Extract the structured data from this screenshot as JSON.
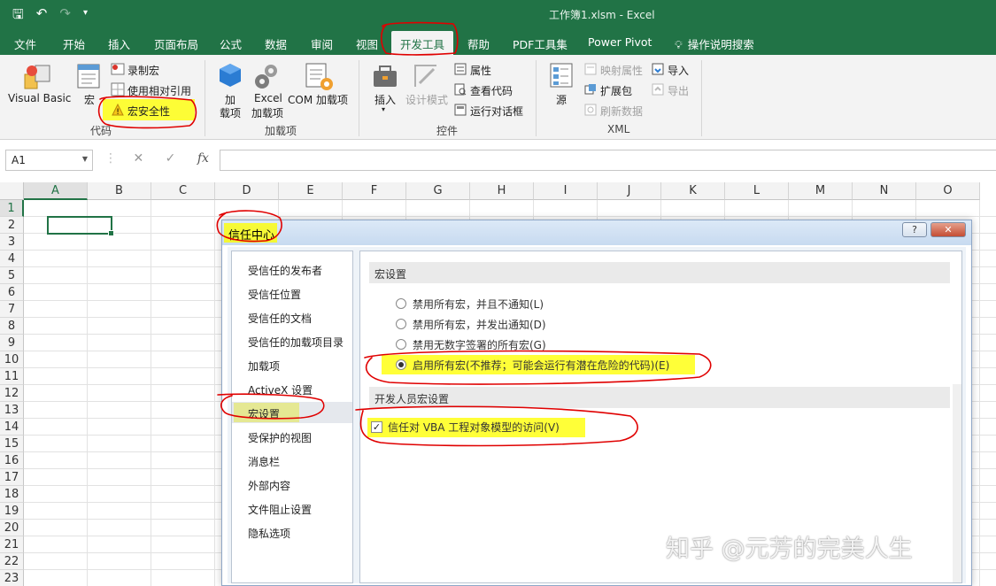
{
  "window": {
    "title": "工作簿1.xlsm  -  Excel",
    "title_bar_color": "#217346"
  },
  "tabs": [
    "文件",
    "开始",
    "插入",
    "页面布局",
    "公式",
    "数据",
    "审阅",
    "视图",
    "开发工具",
    "帮助",
    "PDF工具集",
    "Power Pivot",
    "操作说明搜索"
  ],
  "active_tab": "开发工具",
  "ribbon": {
    "code": {
      "label": "代码",
      "visual_basic": "Visual Basic",
      "macros": "宏",
      "record_macro": "录制宏",
      "relative_ref": "使用相对引用",
      "macro_security": "宏安全性"
    },
    "addins": {
      "label": "加载项",
      "addins_line1": "加",
      "addins_line2": "载项",
      "excel_addins_line1": "Excel",
      "excel_addins_line2": "加载项",
      "com_addins": "COM 加载项"
    },
    "controls": {
      "label": "控件",
      "insert": "插入",
      "design_mode": "设计模式",
      "properties": "属性",
      "view_code": "查看代码",
      "run_dialog": "运行对话框"
    },
    "xml": {
      "label": "XML",
      "source": "源",
      "map_properties": "映射属性",
      "expansion_packs": "扩展包",
      "refresh_data": "刷新数据",
      "import": "导入",
      "export": "导出"
    }
  },
  "formula_bar": {
    "name_box": "A1",
    "fx": "fx",
    "formula": ""
  },
  "grid": {
    "columns": [
      "A",
      "B",
      "C",
      "D",
      "E",
      "F",
      "G",
      "H",
      "I",
      "J",
      "K",
      "L",
      "M",
      "N",
      "O"
    ],
    "rows": [
      "1",
      "2",
      "3",
      "4",
      "5",
      "6",
      "7",
      "8",
      "9",
      "10",
      "11",
      "12",
      "13",
      "14",
      "15",
      "16",
      "17",
      "18",
      "19",
      "20",
      "21",
      "22",
      "23"
    ],
    "selected_cell": "A1"
  },
  "dialog": {
    "title": "信任中心",
    "help_button": "?",
    "close_button": "✕",
    "nav": [
      "受信任的发布者",
      "受信任位置",
      "受信任的文档",
      "受信任的加载项目录",
      "加载项",
      "ActiveX 设置",
      "宏设置",
      "受保护的视图",
      "消息栏",
      "外部内容",
      "文件阻止设置",
      "隐私选项"
    ],
    "nav_selected": "宏设置",
    "macro_settings": {
      "header": "宏设置",
      "options": [
        "禁用所有宏，并且不通知(L)",
        "禁用所有宏，并发出通知(D)",
        "禁用无数字签署的所有宏(G)",
        "启用所有宏(不推荐；可能会运行有潜在危险的代码)(E)"
      ],
      "selected_index": 3
    },
    "developer_settings": {
      "header": "开发人员宏设置",
      "trust_vba_label": "信任对 VBA 工程对象模型的访问(V)",
      "trust_vba_checked": true
    }
  },
  "annotations": {
    "highlight_color": "#ffff00",
    "circle_color": "#e00000"
  },
  "watermark": "知乎 @元芳的完美人生"
}
